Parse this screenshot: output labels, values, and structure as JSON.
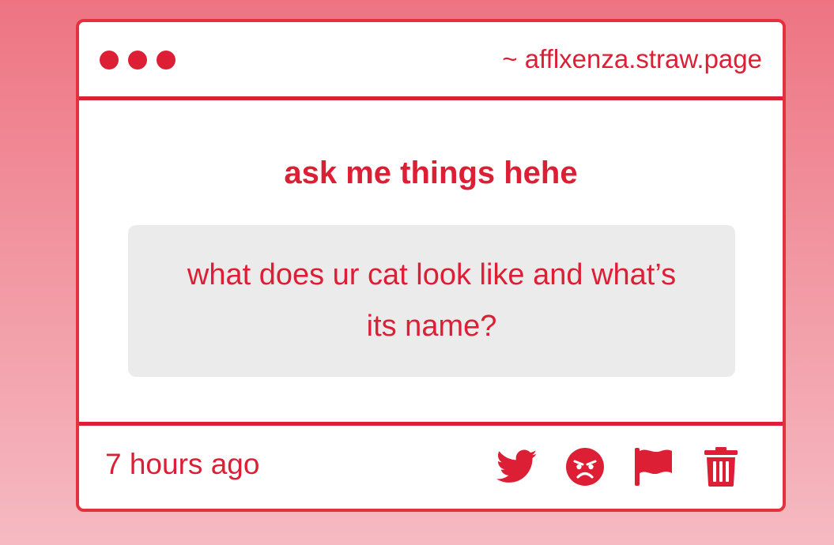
{
  "window": {
    "url": "~ afflxenza.straw.page"
  },
  "prompt": {
    "title": "ask me things hehe"
  },
  "question": {
    "text": "what does ur cat look like and what’s its name?"
  },
  "footer": {
    "timestamp": "7 hours ago",
    "actions": [
      {
        "icon": "twitter-icon"
      },
      {
        "icon": "angry-face-icon"
      },
      {
        "icon": "flag-icon"
      },
      {
        "icon": "trash-icon"
      }
    ]
  },
  "colors": {
    "accent": "#dc1f34",
    "question_bg": "#ecebec",
    "page_bg_top": "#ee7482",
    "page_bg_bottom": "#f6bac2"
  }
}
